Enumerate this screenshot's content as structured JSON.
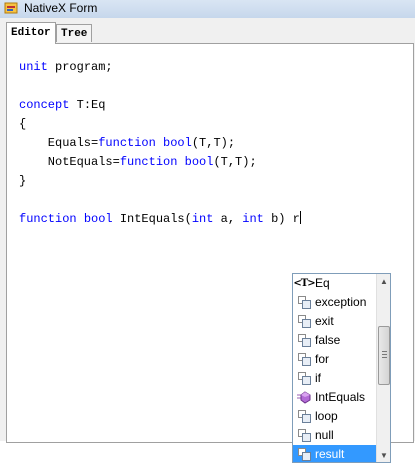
{
  "window": {
    "title": "NativeX Form"
  },
  "tabs": [
    {
      "label": "Editor",
      "active": true
    },
    {
      "label": "Tree",
      "active": false
    }
  ],
  "editor": {
    "lines": [
      {
        "parts": [
          {
            "t": "unit",
            "kw": true
          },
          {
            "t": " program;",
            "kw": false
          }
        ]
      },
      {
        "parts": []
      },
      {
        "parts": [
          {
            "t": "concept",
            "kw": true
          },
          {
            "t": " T:Eq",
            "kw": false
          }
        ]
      },
      {
        "parts": [
          {
            "t": "{",
            "kw": false
          }
        ]
      },
      {
        "parts": [
          {
            "t": "    Equals=",
            "kw": false
          },
          {
            "t": "function",
            "kw": true
          },
          {
            "t": " ",
            "kw": false
          },
          {
            "t": "bool",
            "kw": true
          },
          {
            "t": "(T,T);",
            "kw": false
          }
        ]
      },
      {
        "parts": [
          {
            "t": "    NotEquals=",
            "kw": false
          },
          {
            "t": "function",
            "kw": true
          },
          {
            "t": " ",
            "kw": false
          },
          {
            "t": "bool",
            "kw": true
          },
          {
            "t": "(T,T);",
            "kw": false
          }
        ]
      },
      {
        "parts": [
          {
            "t": "}",
            "kw": false
          }
        ]
      },
      {
        "parts": []
      },
      {
        "parts": [
          {
            "t": "function",
            "kw": true
          },
          {
            "t": " ",
            "kw": false
          },
          {
            "t": "bool",
            "kw": true
          },
          {
            "t": " IntEquals(",
            "kw": false
          },
          {
            "t": "int",
            "kw": true
          },
          {
            "t": " a, ",
            "kw": false
          },
          {
            "t": "int",
            "kw": true
          },
          {
            "t": " b) r",
            "kw": false
          }
        ],
        "caret": true
      }
    ]
  },
  "autocomplete": {
    "items": [
      {
        "label": "Eq",
        "icon": "type-concept-icon",
        "icon_text": "<T>"
      },
      {
        "label": "exception",
        "icon": "keyword-icon"
      },
      {
        "label": "exit",
        "icon": "keyword-icon"
      },
      {
        "label": "false",
        "icon": "keyword-icon"
      },
      {
        "label": "for",
        "icon": "keyword-icon"
      },
      {
        "label": "if",
        "icon": "keyword-icon"
      },
      {
        "label": "IntEquals",
        "icon": "function-member-icon"
      },
      {
        "label": "loop",
        "icon": "keyword-icon"
      },
      {
        "label": "null",
        "icon": "keyword-icon"
      },
      {
        "label": "result",
        "icon": "keyword-icon",
        "selected": true
      }
    ],
    "scroll_position_fraction": 0.38
  },
  "colors": {
    "keyword": "#0000ff",
    "selection": "#3399ff",
    "text": "#000000"
  }
}
